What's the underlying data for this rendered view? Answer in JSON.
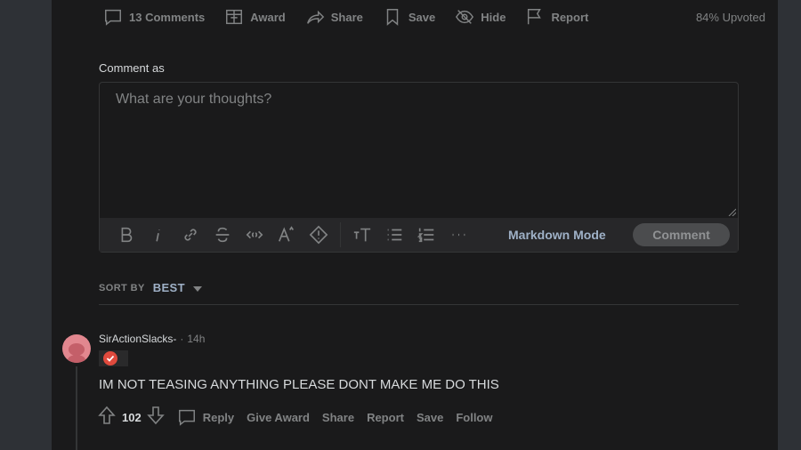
{
  "post_actions": {
    "comments": "13 Comments",
    "award": "Award",
    "share": "Share",
    "save": "Save",
    "hide": "Hide",
    "report": "Report",
    "upvoted": "84% Upvoted"
  },
  "editor": {
    "comment_as_label": "Comment as",
    "placeholder": "What are your thoughts?",
    "value": "",
    "markdown_mode": "Markdown Mode",
    "comment_button": "Comment",
    "toolbar_icons": [
      "bold-icon",
      "italic-icon",
      "link-icon",
      "strikethrough-icon",
      "inline-code-icon",
      "superscript-icon",
      "spoiler-icon",
      "heading-icon",
      "bulleted-list-icon",
      "numbered-list-icon",
      "more-icon"
    ]
  },
  "sort": {
    "label": "SORT BY",
    "value": "BEST"
  },
  "comment": {
    "author": "SirActionSlacks-",
    "dot": "·",
    "time": "14h",
    "body": "IM NOT TEASING ANYTHING PLEASE DONT MAKE ME DO THIS",
    "score": "102",
    "actions": {
      "reply": "Reply",
      "give_award": "Give Award",
      "share": "Share",
      "report": "Report",
      "save": "Save",
      "follow": "Follow"
    }
  },
  "colors": {
    "page_bg": "#2e3136",
    "panel_bg": "#1a1a1b",
    "text": "#d7dadc",
    "muted": "#818384",
    "accent": "#9fb1c7",
    "avatar": "#e2878f",
    "flair": "#e04a3d"
  }
}
